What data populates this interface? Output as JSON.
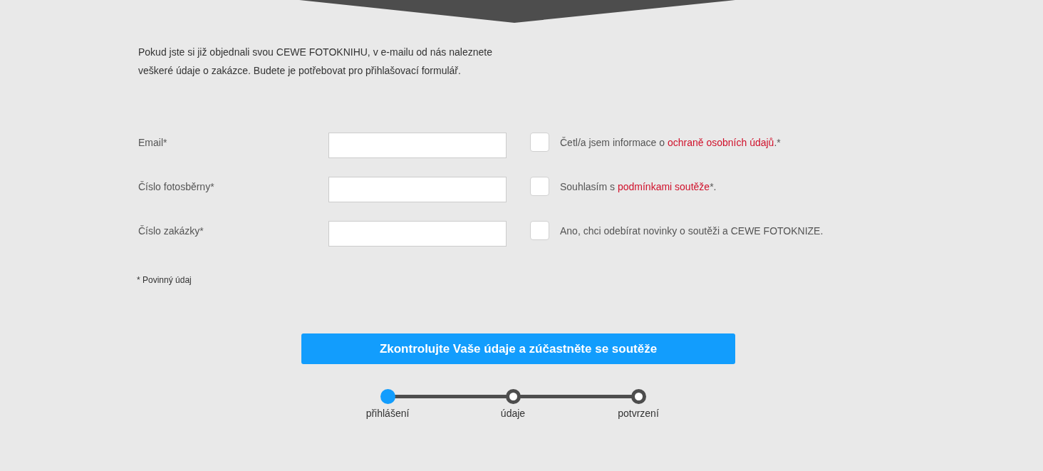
{
  "intro": "Pokud jste si již objednali svou CEWE FOTOKNIHU, v e-mailu od nás naleznete veškeré údaje o zakázce. Budete je potřebovat pro přihlašovací formulář.",
  "fields": [
    {
      "label": "Email*"
    },
    {
      "label": "Číslo fotosběrny*"
    },
    {
      "label": "Číslo zakázky*"
    }
  ],
  "consents": [
    {
      "checked": false,
      "text_before": "Četl/a jsem informace o ",
      "link": "ochraně osobních údajů",
      "text_after": ".*"
    },
    {
      "checked": false,
      "text_before": "Souhlasím s ",
      "link": "podmínkami soutěže",
      "text_after": "*."
    },
    {
      "checked": false,
      "text_before": "Ano, chci odebírat novinky o soutěži a CEWE FOTOKNIZE."
    }
  ],
  "required_note": "* Povinný údaj",
  "submit_button": "Zkontrolujte Vaše údaje a zúčastněte se soutěže",
  "steps": [
    {
      "label": "přihlášení",
      "selected": true
    },
    {
      "label": "údaje",
      "selected": false
    },
    {
      "label": "potvrzení",
      "selected": false
    }
  ]
}
